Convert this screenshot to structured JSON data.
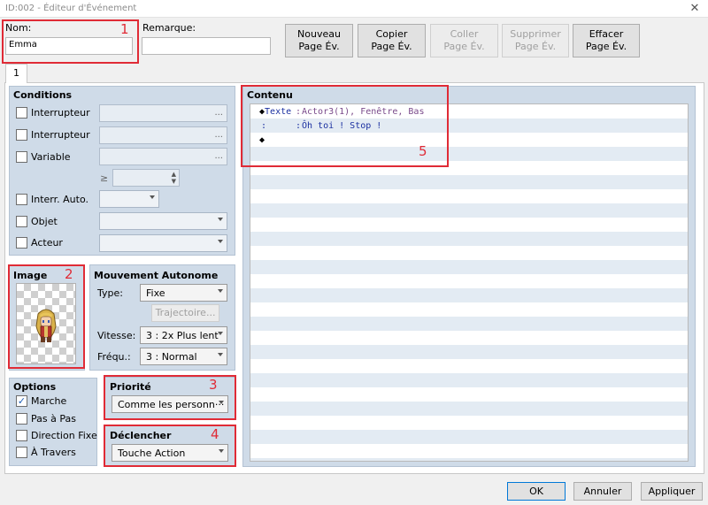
{
  "window": {
    "title": "ID:002 - Éditeur d'Événement"
  },
  "icons": {
    "close": "close-icon",
    "check": "check-icon",
    "diamond": "diamond-icon",
    "character": "character-sprite-icon",
    "ellipsis": "ellipsis-icon"
  },
  "top": {
    "name_label": "Nom:",
    "name_value": "Emma",
    "remark_label": "Remarque:",
    "remark_value": ""
  },
  "buttons": {
    "new_l1": "Nouveau",
    "new_l2": "Page Év.",
    "copy_l1": "Copier",
    "copy_l2": "Page Év.",
    "paste_l1": "Coller",
    "paste_l2": "Page Év.",
    "delete_l1": "Supprimer",
    "delete_l2": "Page Év.",
    "clear_l1": "Effacer",
    "clear_l2": "Page Év."
  },
  "tabs": [
    {
      "label": "1"
    }
  ],
  "conditions": {
    "title": "Conditions",
    "switch1": "Interrupteur",
    "switch2": "Interrupteur",
    "variable": "Variable",
    "ge": "≥",
    "self_switch": "Interr. Auto.",
    "item": "Objet",
    "actor": "Acteur",
    "dots": "..."
  },
  "image": {
    "title": "Image"
  },
  "movement": {
    "title": "Mouvement Autonome",
    "type_label": "Type:",
    "type_value": "Fixe",
    "route_button": "Trajectoire...",
    "speed_label": "Vitesse:",
    "speed_value": "3 : 2x Plus lent",
    "freq_label": "Fréqu.:",
    "freq_value": "3 : Normal"
  },
  "options": {
    "title": "Options",
    "walking": "Marche",
    "stepping": "Pas à Pas",
    "direction_fix": "Direction Fixe",
    "through": "À Travers"
  },
  "priority": {
    "title": "Priorité",
    "value": "Comme les personn···"
  },
  "trigger": {
    "title": "Déclencher",
    "value": "Touche Action"
  },
  "content": {
    "title": "Contenu",
    "lines": [
      {
        "diamond": "◆",
        "cmd": "Texte",
        "sep": ":",
        "args": "Actor3(1), Fenêtre, Bas"
      },
      {
        "diamond": "",
        "cmd": ":",
        "sep": ":",
        "args": "Ôh toi ! Stop !"
      },
      {
        "diamond": "◆",
        "cmd": "",
        "sep": "",
        "args": ""
      }
    ]
  },
  "annotations": {
    "n1": "1",
    "n2": "2",
    "n3": "3",
    "n4": "4",
    "n5": "5"
  },
  "footer": {
    "ok": "OK",
    "cancel": "Annuler",
    "apply": "Appliquer"
  },
  "colors": {
    "annotation_red": "#e02b36",
    "panel_blue": "#cfdbe8",
    "args_purple": "#7a4a8a",
    "text_blue": "#1a2fa0"
  }
}
